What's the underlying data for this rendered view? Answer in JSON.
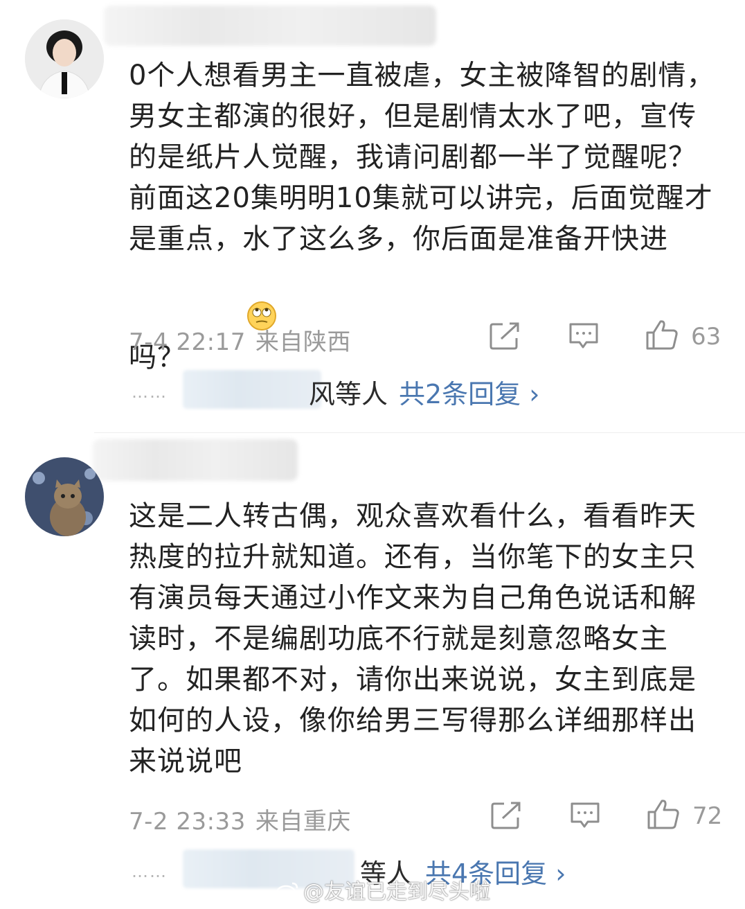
{
  "comments": [
    {
      "text": "0个人想看男主一直被虐，女主被降智的剧情，男女主都演的很好，但是剧情太水了吧，宣传的是纸片人觉醒，我请问剧都一半了觉醒呢？前面这20集明明10集就可以讲完，后面觉醒才是重点，水了这么多，你后面是准备开快进吗？",
      "emoji": "face-with-rolling-eyes",
      "time": "7-4 22:17",
      "location": "来自陕西",
      "likes": "63",
      "replies_etc": "风等人",
      "replies_total": "共2条回复 ›"
    },
    {
      "text": "这是二人转古偶，观众喜欢看什么，看看昨天热度的拉升就知道。还有，当你笔下的女主只有演员每天通过小作文来为自己角色说话和解读时，不是编剧功底不行就是刻意忽略女主了。如果都不对，请你出来说说，女主到底是如何的人设，像你给男三写得那么详细那样出来说说吧",
      "time": "7-2 23:33",
      "location": "来自重庆",
      "likes": "72",
      "replies_etc": "等人",
      "replies_total": "共4条回复 ›"
    }
  ],
  "reply_dots": "……",
  "watermark": "@友谊已走到尽头啦",
  "icons": {
    "share": "share-icon",
    "comment": "comment-icon",
    "like": "thumbs-up-icon"
  }
}
